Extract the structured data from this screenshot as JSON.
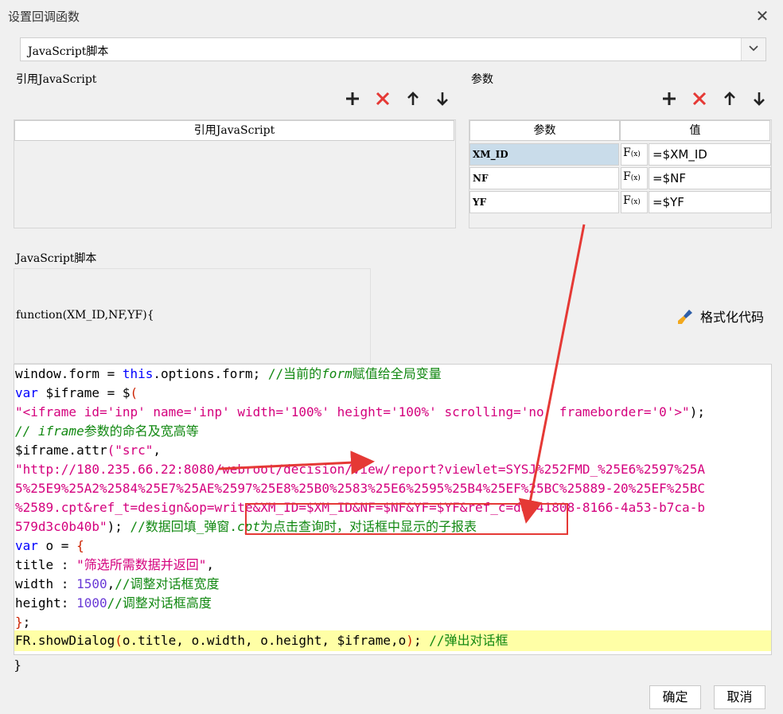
{
  "dialog": {
    "title": "设置回调函数"
  },
  "script_type": {
    "selected": "JavaScript脚本"
  },
  "ref_section": {
    "label": "引用JavaScript",
    "column_header": "引用JavaScript"
  },
  "params_section": {
    "label": "参数",
    "columns": [
      "参数",
      "值"
    ],
    "rows": [
      {
        "name": "XM_ID",
        "fx": "F",
        "fx_sub": "(x)",
        "value": "=$XM_ID",
        "selected": true
      },
      {
        "name": "NF",
        "fx": "F",
        "fx_sub": "(x)",
        "value": "=$NF",
        "selected": false
      },
      {
        "name": "YF",
        "fx": "F",
        "fx_sub": "(x)",
        "value": "=$YF",
        "selected": false
      }
    ]
  },
  "toolbar_icons": [
    "plus-icon",
    "delete-x-icon",
    "arrow-up-icon",
    "arrow-down-icon"
  ],
  "script_section": {
    "label": "JavaScript脚本",
    "function_signature": "function(XM_ID,NF,YF){",
    "format_button": "格式化代码",
    "closing_brace": "}"
  },
  "code": {
    "l1a": "window.form = ",
    "l1b": "this",
    "l1c": ".options.form; ",
    "l1d": "//当前的",
    "l1e": "form",
    "l1f": "赋值给全局变量",
    "l2a": "var",
    "l2b": " $iframe = $",
    "l2c": "(",
    "l3": "\"<iframe id='inp' name='inp' width='100%' height='100%' scrolling='no' frameborder='0'>\"",
    "l3b": ");",
    "l4a": "// iframe",
    "l4b": "参数的命名及宽高等",
    "l5a": "$iframe.attr",
    "l5b": "(\"src\"",
    "l5c": ",",
    "l6": "\"http://180.235.66.22:8080/webroot/decision/view/report?viewlet=SYSJ%252FMD_%25E6%2597%25A",
    "l7": "5%25E9%25A2%2584%25E7%25AE%2597%25E8%25B0%2583%25E6%2595%25B4%25EF%25BC%25889-20%25EF%25BC",
    "l8": "%2589.cpt&ref_t=design&op=write&XM_ID=$XM_ID&NF=$NF&YF=$YF&ref_c=da841808-8166-4a53-b7ca-b",
    "l9a": "579d3c0b40b\"",
    "l9b": "); ",
    "l9c": "//数据回填_弹窗.",
    "l9d": "cpt",
    "l9e": "为点击查询时，对话框中显示的子报表",
    "l10a": "var",
    "l10b": " o = ",
    "l10c": "{",
    "l11a": "title : ",
    "l11b": "\"筛选所需数据并返回\"",
    "l11c": ",",
    "l12a": "width : ",
    "l12b": "1500",
    "l12c": ",",
    "l12d": "//调整对话框宽度",
    "l13a": "height: ",
    "l13b": "1000",
    "l13c": "//调整对话框高度",
    "l14a": "}",
    "l14b": ";",
    "l15a": "FR.showDialog",
    "l15b": "(",
    "l15c": "o.title, o.width, o.height, $iframe,o",
    "l15d": ")",
    "l15e": "; ",
    "l15f": "//弹出对话框"
  },
  "footer": {
    "ok": "确定",
    "cancel": "取消"
  },
  "colors": {
    "annotation": "#e53935",
    "highlight_line": "#ffffa6",
    "selected_cell": "#c9dcea"
  }
}
